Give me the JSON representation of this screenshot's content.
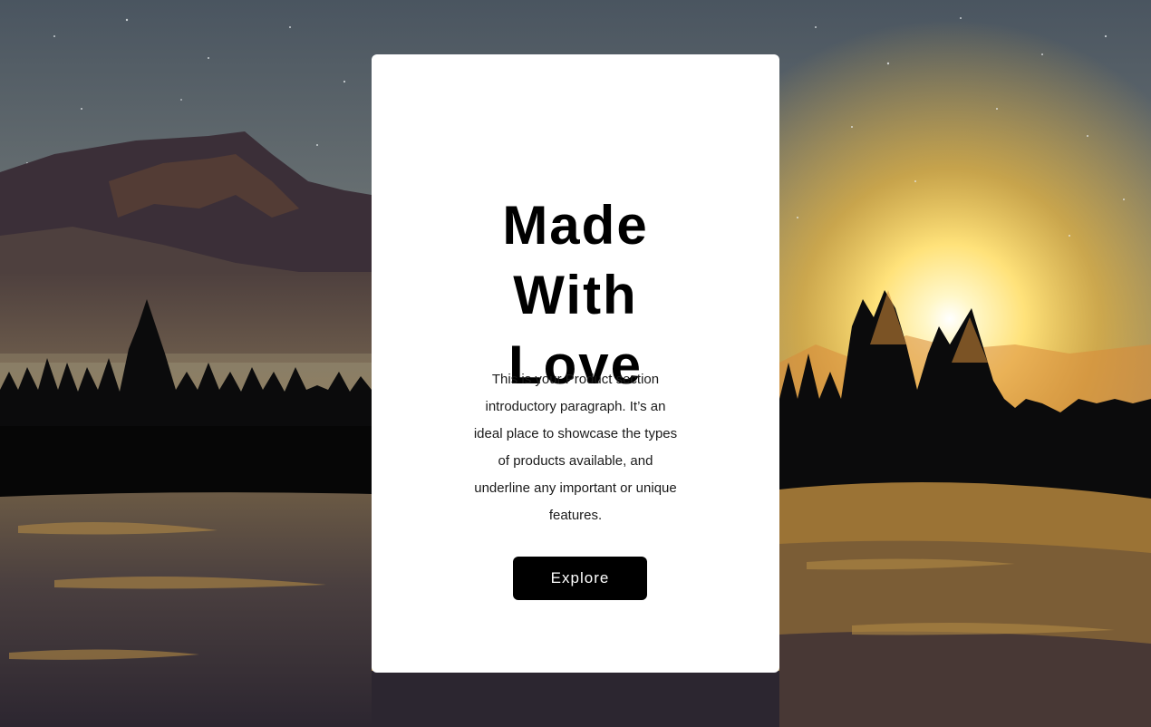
{
  "hero": {
    "headline_lines": [
      "Made",
      "With",
      "Love"
    ],
    "intro": "This is your Product section introductory paragraph. It’s an ideal place to showcase the types of products available, and underline any important or unique features.",
    "button_label": "Explore"
  },
  "colors": {
    "card_background": "#ffffff",
    "button_background": "#000000",
    "button_text": "#ffffff",
    "heading_text": "#000000"
  }
}
